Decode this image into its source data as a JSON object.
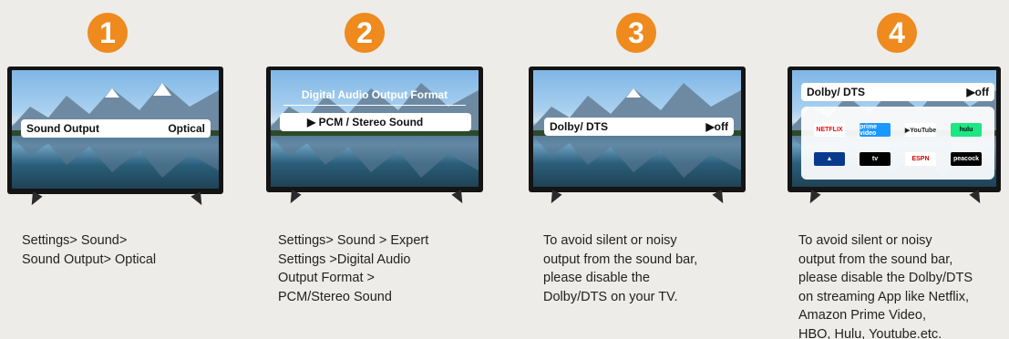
{
  "steps": [
    {
      "number": "1",
      "osd": {
        "label": "Sound Output",
        "value": "Optical"
      },
      "caption": "Settings> Sound>\nSound Output> Optical"
    },
    {
      "number": "2",
      "osd": {
        "title": "Digital Audio Output Format",
        "label": "▶ PCM / Stereo Sound"
      },
      "caption": "Settings> Sound > Expert\nSettings >Digital Audio\nOutput Format >\nPCM/Stereo Sound"
    },
    {
      "number": "3",
      "osd": {
        "label": "Dolby/ DTS",
        "value": "▶off"
      },
      "caption": "To avoid silent or noisy\noutput from the sound bar,\nplease disable the\nDolby/DTS on your TV."
    },
    {
      "number": "4",
      "osd": {
        "label": "Dolby/ DTS",
        "value": "▶off"
      },
      "apps": [
        {
          "name": "NETFLIX",
          "bg": "#ffffff",
          "fg": "#e50914"
        },
        {
          "name": "prime video",
          "bg": "#1a98ff",
          "fg": "#ffffff"
        },
        {
          "name": "▶YouTube",
          "bg": "#ffffff",
          "fg": "#222222"
        },
        {
          "name": "hulu",
          "bg": "#1ce783",
          "fg": "#0b0c0f"
        },
        {
          "name": "▲",
          "bg": "#0a3a8c",
          "fg": "#ffffff"
        },
        {
          "name": " tv",
          "bg": "#000000",
          "fg": "#ffffff"
        },
        {
          "name": "ESPN",
          "bg": "#ffffff",
          "fg": "#d00000"
        },
        {
          "name": "peacock",
          "bg": "#000000",
          "fg": "#ffffff"
        }
      ],
      "caption": "To avoid silent or noisy\noutput from the sound bar,\nplease disable the Dolby/DTS\non streaming App like Netflix,\nAmazon Prime Video,\nHBO, Hulu, Youtube.etc."
    }
  ],
  "colors": {
    "badge": "#ee8a1e",
    "background": "#eeece8"
  }
}
